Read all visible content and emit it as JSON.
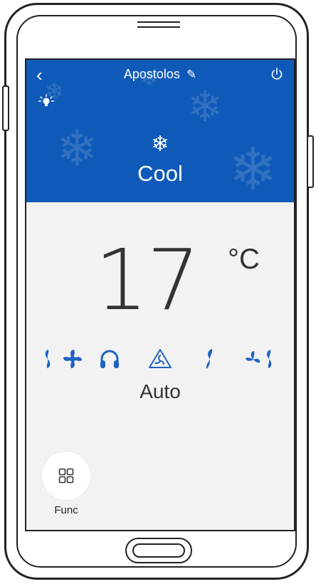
{
  "header": {
    "title": "Apostolos",
    "mode_label": "Cool",
    "accent_color": "#0f5ab8"
  },
  "icons": {
    "back": "back-icon",
    "edit": "edit-pencil-icon",
    "power": "power-icon",
    "light": "light-bulb-icon",
    "mode": "snowflake-icon"
  },
  "temperature": {
    "value": "17",
    "unit": "°C"
  },
  "fan": {
    "selected_label": "Auto",
    "options": [
      "fan-speed-low-icon",
      "fan-speed-turbo-icon",
      "fan-speed-silent-icon",
      "fan-speed-auto-icon",
      "fan-speed-mid-icon",
      "fan-speed-high-icon"
    ]
  },
  "func": {
    "label": "Func"
  }
}
